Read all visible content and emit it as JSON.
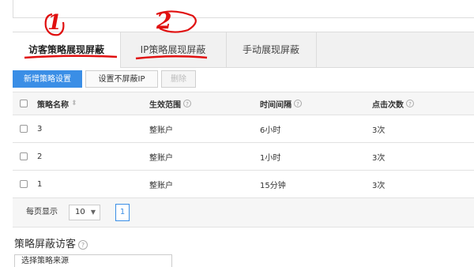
{
  "tabs": [
    {
      "label": "访客策略展现屏蔽",
      "active": true
    },
    {
      "label": "IP策略展现屏蔽",
      "active": false
    },
    {
      "label": "手动展现屏蔽",
      "active": false
    }
  ],
  "annotations": {
    "num1": "1",
    "num2": "2",
    "color": "#e01010"
  },
  "toolbar": {
    "add_label": "新增策略设置",
    "ip_exempt_label": "设置不屏蔽IP",
    "delete_label": "删除"
  },
  "table": {
    "headers": [
      "策略名称",
      "生效范围",
      "时间间隔",
      "点击次数"
    ],
    "rows": [
      {
        "name": "3",
        "scope": "整账户",
        "interval": "6小时",
        "clicks": "3次"
      },
      {
        "name": "2",
        "scope": "整账户",
        "interval": "1小时",
        "clicks": "3次"
      },
      {
        "name": "1",
        "scope": "整账户",
        "interval": "15分钟",
        "clicks": "3次"
      }
    ]
  },
  "pager": {
    "label": "每页显示",
    "page_size": "10",
    "current_page": "1"
  },
  "section": {
    "title": "策略屏蔽访客",
    "input_text": "选择策略来源"
  },
  "colors": {
    "primary": "#3a8ee6",
    "annotation": "#e01010"
  }
}
